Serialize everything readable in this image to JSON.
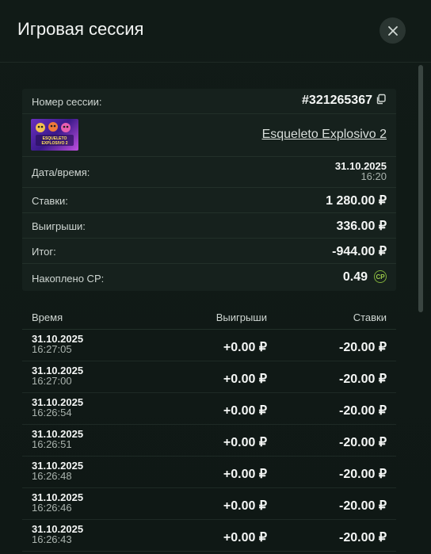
{
  "header": {
    "title": "Игровая сессия"
  },
  "summary": {
    "session_label": "Номер сессии:",
    "session_value": "#321265367",
    "game_name": "Esqueleto Explosivo 2",
    "game_thumb_text": "ESQUELETO EXPLOSIVO 2",
    "datetime_label": "Дата/время:",
    "datetime_date": "31.10.2025",
    "datetime_time": "16:20",
    "bets_label": "Ставки:",
    "bets_value": "1 280.00 ₽",
    "wins_label": "Выигрыши:",
    "wins_value": "336.00 ₽",
    "total_label": "Итог:",
    "total_value": "-944.00 ₽",
    "cp_label": "Накоплено CP:",
    "cp_value": "0.49",
    "cp_badge": "CP"
  },
  "table": {
    "columns": {
      "time": "Время",
      "wins": "Выигрыши",
      "bets": "Ставки"
    },
    "rows": [
      {
        "date": "31.10.2025",
        "time": "16:27:05",
        "win": "+0.00 ₽",
        "bet": "-20.00 ₽"
      },
      {
        "date": "31.10.2025",
        "time": "16:27:00",
        "win": "+0.00 ₽",
        "bet": "-20.00 ₽"
      },
      {
        "date": "31.10.2025",
        "time": "16:26:54",
        "win": "+0.00 ₽",
        "bet": "-20.00 ₽"
      },
      {
        "date": "31.10.2025",
        "time": "16:26:51",
        "win": "+0.00 ₽",
        "bet": "-20.00 ₽"
      },
      {
        "date": "31.10.2025",
        "time": "16:26:48",
        "win": "+0.00 ₽",
        "bet": "-20.00 ₽"
      },
      {
        "date": "31.10.2025",
        "time": "16:26:46",
        "win": "+0.00 ₽",
        "bet": "-20.00 ₽"
      },
      {
        "date": "31.10.2025",
        "time": "16:26:43",
        "win": "+0.00 ₽",
        "bet": "-20.00 ₽"
      }
    ]
  },
  "icons": {
    "close": "close-icon",
    "copy": "copy-icon",
    "cp": "cp-coin-icon"
  },
  "colors": {
    "background": "#111b17",
    "panel": "#16211d",
    "cp_accent": "#9cc94a"
  }
}
